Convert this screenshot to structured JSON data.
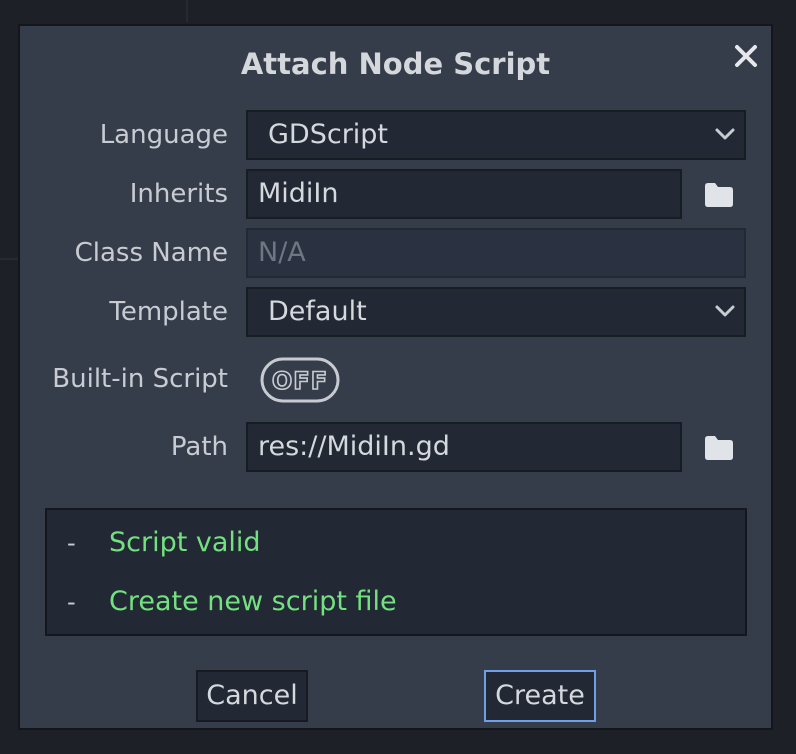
{
  "dialog": {
    "title": "Attach Node Script"
  },
  "form": {
    "language": {
      "label": "Language",
      "value": "GDScript"
    },
    "inherits": {
      "label": "Inherits",
      "value": "MidiIn"
    },
    "class_name": {
      "label": "Class Name",
      "placeholder": "N/A"
    },
    "template": {
      "label": "Template",
      "value": "Default"
    },
    "builtin_script": {
      "label": "Built-in Script",
      "toggle_text": "OFF"
    },
    "path": {
      "label": "Path",
      "value": "res://MidiIn.gd"
    }
  },
  "status": {
    "items": [
      {
        "dash": "-",
        "text": "Script valid"
      },
      {
        "dash": "-",
        "text": "Create new script file"
      }
    ]
  },
  "buttons": {
    "cancel": "Cancel",
    "create": "Create"
  },
  "colors": {
    "dialog_bg": "#363d4a",
    "field_bg": "#222834",
    "status_ok": "#73e17f",
    "primary_border": "#6f9fe8"
  },
  "icons": {
    "close": "close-icon",
    "folder": "folder-icon",
    "chevron": "chevron-down-icon"
  }
}
